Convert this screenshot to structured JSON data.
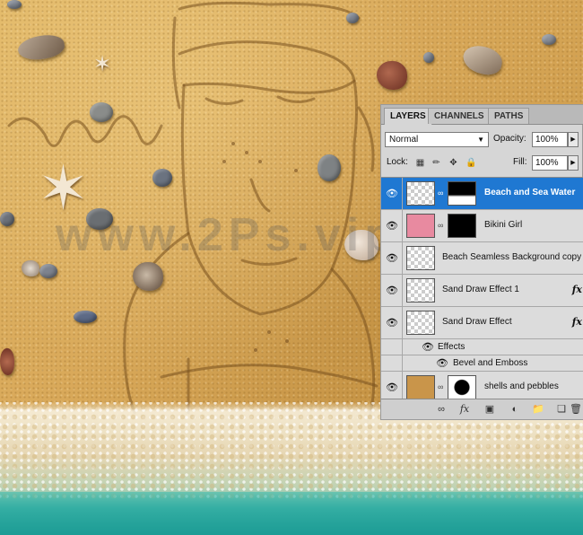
{
  "watermark": "www.2Ps.vip.com",
  "layers_panel": {
    "tabs": [
      {
        "label": "LAYERS",
        "active": true
      },
      {
        "label": "CHANNELS",
        "active": false
      },
      {
        "label": "PATHS",
        "active": false
      }
    ],
    "blend_mode": "Normal",
    "opacity_label": "Opacity:",
    "opacity_value": "100%",
    "lock_label": "Lock:",
    "fill_label": "Fill:",
    "fill_value": "100%",
    "layers": [
      {
        "name": "Beach and Sea Water",
        "selected": true,
        "visible": true,
        "has_mask": true
      },
      {
        "name": "Bikini Girl",
        "selected": false,
        "visible": true,
        "has_mask": true
      },
      {
        "name": "Beach Seamless Background copy",
        "selected": false,
        "visible": true,
        "has_mask": false
      },
      {
        "name": "Sand Draw Effect 1",
        "selected": false,
        "visible": true,
        "has_fx": true
      },
      {
        "name": "Sand Draw Effect",
        "selected": false,
        "visible": true,
        "has_fx": true
      },
      {
        "name": "Effects",
        "sub": true
      },
      {
        "name": "Bevel and Emboss",
        "sub": true
      },
      {
        "name": "shells and pebbles",
        "selected": false,
        "visible": true,
        "has_mask": true
      }
    ],
    "fx_label": "fx",
    "colors": {
      "selected": "#1f78d2",
      "panel": "#d6d6d6"
    },
    "bottom_icons": [
      "link-icon",
      "fx-icon",
      "mask-icon",
      "adjustment-icon",
      "folder-icon",
      "new-layer-icon",
      "trash-icon"
    ]
  }
}
